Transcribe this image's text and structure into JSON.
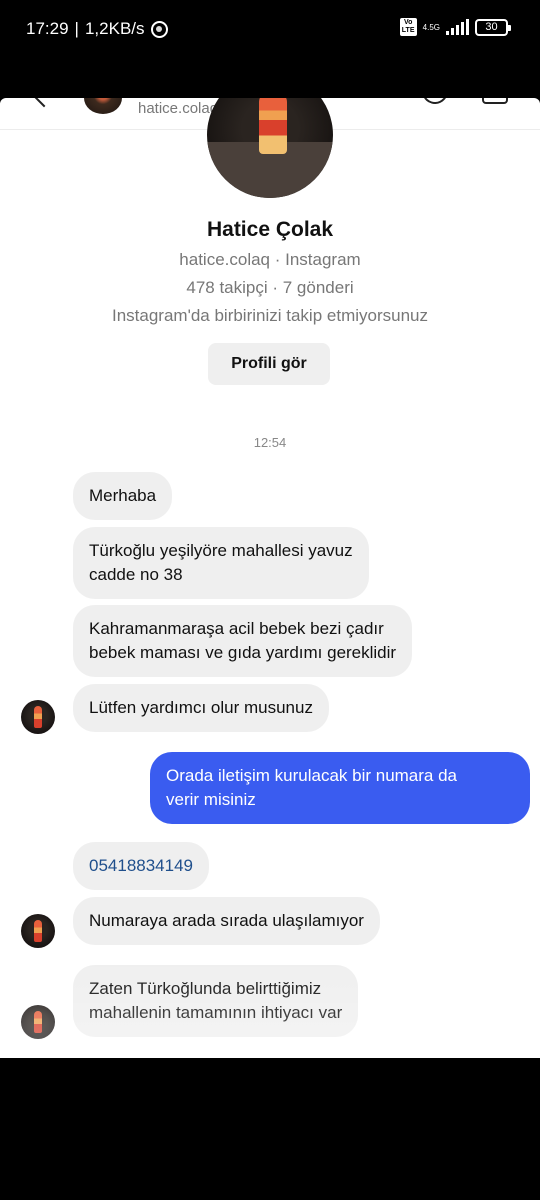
{
  "status_bar": {
    "time": "17:29",
    "separator": "|",
    "net_speed": "1,2KB/s",
    "volte": "Vo LTE",
    "network": "4.5G",
    "battery": "30"
  },
  "header": {
    "username": "hatice.colaq"
  },
  "profile": {
    "name": "Hatice Çolak",
    "handle_line": "hatice.colaq · Instagram",
    "stats_line": "478 takipçi · 7 gönderi",
    "follow_status": "Instagram'da birbirinizi takip etmiyorsunuz",
    "view_profile_label": "Profili gör"
  },
  "chat": {
    "timestamp": "12:54",
    "messages": [
      {
        "direction": "in",
        "lines": [
          "Merhaba"
        ]
      },
      {
        "direction": "in",
        "lines": [
          "Türkoğlu yeşilyöre mahallesi yavuz",
          "cadde no 38"
        ]
      },
      {
        "direction": "in",
        "lines": [
          "Kahramanmaraşa acil bebek bezi çadır",
          "bebek maması ve gıda yardımı gereklidir"
        ]
      },
      {
        "direction": "in",
        "lines": [
          "Lütfen yardımcı olur musunuz"
        ]
      },
      {
        "direction": "out",
        "lines": [
          "Orada iletişim kurulacak bir numara da",
          "verir misiniz"
        ]
      },
      {
        "direction": "in",
        "lines": [
          "05418834149"
        ]
      },
      {
        "direction": "in",
        "lines": [
          "Numaraya arada sırada ulaşılamıyor"
        ]
      },
      {
        "direction": "in",
        "lines": [
          "Zaten Türkoğlunda belirttiğimiz",
          "mahallenin tamamının ihtiyacı var"
        ]
      }
    ]
  },
  "colors": {
    "outgoing_bubble": "#3a5cf0",
    "incoming_bubble": "#efefef",
    "phone_link": "#1f4f8c"
  },
  "icons": [
    "whatsapp-icon",
    "back-icon",
    "phone-call-icon",
    "video-call-icon",
    "signal-icon",
    "battery-icon"
  ]
}
